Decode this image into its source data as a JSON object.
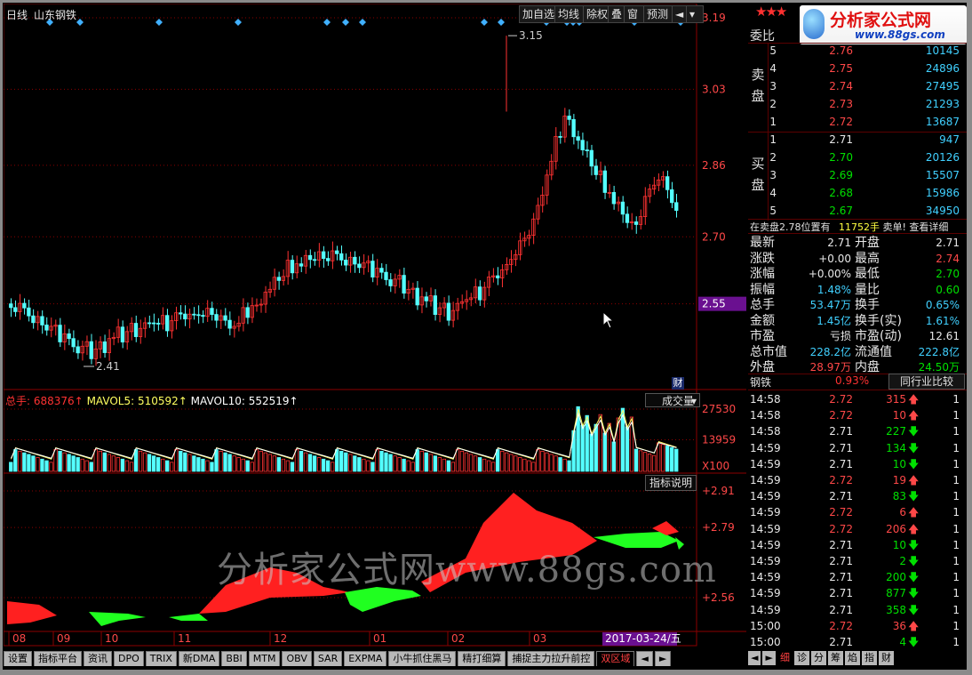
{
  "header": {
    "period": "日线",
    "stock_name": "山东钢铁",
    "buttons": [
      "加自选",
      "均线",
      "除权",
      "叠",
      "窗",
      "预测"
    ]
  },
  "price_axis": {
    "ticks": [
      "3.19",
      "3.03",
      "2.86",
      "2.70",
      "2.55"
    ]
  },
  "annotations": {
    "high_label": "3.15",
    "low_label": "2.41",
    "cai_tag": "财"
  },
  "volume_header": {
    "total_label": "总手: 688376↑",
    "mavol5_label": "MAVOL5: 510592↑",
    "mavol10_label": "MAVOL10: 552519↑",
    "dropdown": "成交量",
    "ticks": [
      "27530",
      "13959"
    ],
    "multiplier": "X100"
  },
  "indicator": {
    "button": "指标说明",
    "ticks": [
      "+2.91",
      "+2.79",
      "+2.56"
    ]
  },
  "date_axis": {
    "labels": [
      "08",
      "09",
      "10",
      "11",
      "12",
      "01",
      "02",
      "03"
    ],
    "highlight": "2017-03-24/五"
  },
  "bottom_tabs": [
    "设置",
    "指标平台",
    "资讯",
    "DPO",
    "TRIX",
    "新DMA",
    "BBI",
    "MTM",
    "OBV",
    "SAR",
    "EXPMA",
    "小牛抓住黑马",
    "精打细算",
    "捕捉主力拉升前控",
    "双区域"
  ],
  "watermark": "分析家公式网www.88gs.com",
  "logo": {
    "text": "分析家公式网",
    "url": "www.88gs.com"
  },
  "orderbook": {
    "weibi_label": "委比",
    "sell_label": "卖盘",
    "buy_label": "买盘",
    "sell": [
      {
        "level": "5",
        "price": "2.76",
        "vol": "10145"
      },
      {
        "level": "4",
        "price": "2.75",
        "vol": "24896"
      },
      {
        "level": "3",
        "price": "2.74",
        "vol": "27495"
      },
      {
        "level": "2",
        "price": "2.73",
        "vol": "21293"
      },
      {
        "level": "1",
        "price": "2.72",
        "vol": "13687"
      }
    ],
    "buy": [
      {
        "level": "1",
        "price": "2.71",
        "vol": "947"
      },
      {
        "level": "2",
        "price": "2.70",
        "vol": "20126"
      },
      {
        "level": "3",
        "price": "2.69",
        "vol": "15507"
      },
      {
        "level": "4",
        "price": "2.68",
        "vol": "15986"
      },
      {
        "level": "5",
        "price": "2.67",
        "vol": "34950"
      }
    ],
    "notice_left": "在卖盘2.78位置有",
    "notice_vol": "11752手",
    "notice_right": "卖单! 查看详细"
  },
  "quote": [
    {
      "l1": "最新",
      "v1": "2.71",
      "c1": "white",
      "l2": "开盘",
      "v2": "2.71",
      "c2": "white"
    },
    {
      "l1": "涨跌",
      "v1": "+0.00",
      "c1": "white",
      "l2": "最高",
      "v2": "2.74",
      "c2": "red"
    },
    {
      "l1": "涨幅",
      "v1": "+0.00%",
      "c1": "white",
      "l2": "最低",
      "v2": "2.70",
      "c2": "green"
    },
    {
      "l1": "振幅",
      "v1": "1.48%",
      "c1": "cyan",
      "l2": "量比",
      "v2": "0.60",
      "c2": "green"
    },
    {
      "l1": "总手",
      "v1": "53.47万",
      "c1": "cyan",
      "l2": "换手",
      "v2": "0.65%",
      "c2": "cyan"
    },
    {
      "l1": "金额",
      "v1": "1.45亿",
      "c1": "cyan",
      "l2": "换手(实)",
      "v2": "1.61%",
      "c2": "cyan"
    },
    {
      "l1": "市盈",
      "v1": "亏损",
      "c1": "white",
      "l2": "市盈(动)",
      "v2": "12.61",
      "c2": "white"
    },
    {
      "l1": "总市值",
      "v1": "228.2亿",
      "c1": "cyan",
      "l2": "流通值",
      "v2": "222.8亿",
      "c2": "cyan"
    },
    {
      "l1": "外盘",
      "v1": "28.97万",
      "c1": "red",
      "l2": "内盘",
      "v2": "24.50万",
      "c2": "green"
    }
  ],
  "industry": {
    "name": "钢铁",
    "pct": "0.93%",
    "button": "同行业比较"
  },
  "ticks": [
    {
      "time": "14:58",
      "price": "2.72",
      "pc": "red",
      "vol": "315",
      "dir": "up",
      "n": "1"
    },
    {
      "time": "14:58",
      "price": "2.72",
      "pc": "red",
      "vol": "10",
      "dir": "up",
      "n": "1"
    },
    {
      "time": "14:58",
      "price": "2.71",
      "pc": "white",
      "vol": "227",
      "dir": "down",
      "n": "1"
    },
    {
      "time": "14:59",
      "price": "2.71",
      "pc": "white",
      "vol": "134",
      "dir": "down",
      "n": "1"
    },
    {
      "time": "14:59",
      "price": "2.71",
      "pc": "white",
      "vol": "10",
      "dir": "down",
      "n": "1"
    },
    {
      "time": "14:59",
      "price": "2.72",
      "pc": "red",
      "vol": "19",
      "dir": "up",
      "n": "1"
    },
    {
      "time": "14:59",
      "price": "2.71",
      "pc": "white",
      "vol": "83",
      "dir": "down",
      "n": "1"
    },
    {
      "time": "14:59",
      "price": "2.72",
      "pc": "red",
      "vol": "6",
      "dir": "up",
      "n": "1"
    },
    {
      "time": "14:59",
      "price": "2.72",
      "pc": "red",
      "vol": "206",
      "dir": "up",
      "n": "1"
    },
    {
      "time": "14:59",
      "price": "2.71",
      "pc": "white",
      "vol": "10",
      "dir": "down",
      "n": "1"
    },
    {
      "time": "14:59",
      "price": "2.71",
      "pc": "white",
      "vol": "2",
      "dir": "down",
      "n": "1"
    },
    {
      "time": "14:59",
      "price": "2.71",
      "pc": "white",
      "vol": "200",
      "dir": "down",
      "n": "1"
    },
    {
      "time": "14:59",
      "price": "2.71",
      "pc": "white",
      "vol": "877",
      "dir": "down",
      "n": "1"
    },
    {
      "time": "14:59",
      "price": "2.71",
      "pc": "white",
      "vol": "358",
      "dir": "down",
      "n": "1"
    },
    {
      "time": "15:00",
      "price": "2.72",
      "pc": "red",
      "vol": "36",
      "dir": "up",
      "n": "1"
    },
    {
      "time": "15:00",
      "price": "2.71",
      "pc": "white",
      "vol": "4",
      "dir": "down",
      "n": "1"
    }
  ],
  "right_tabs": [
    "细",
    "诊",
    "分",
    "筹",
    "焰",
    "指",
    "财"
  ],
  "colors": {
    "up": "#ff3232",
    "down": "#54ffff",
    "grid": "#8b0000",
    "ma": "#ffffff"
  }
}
